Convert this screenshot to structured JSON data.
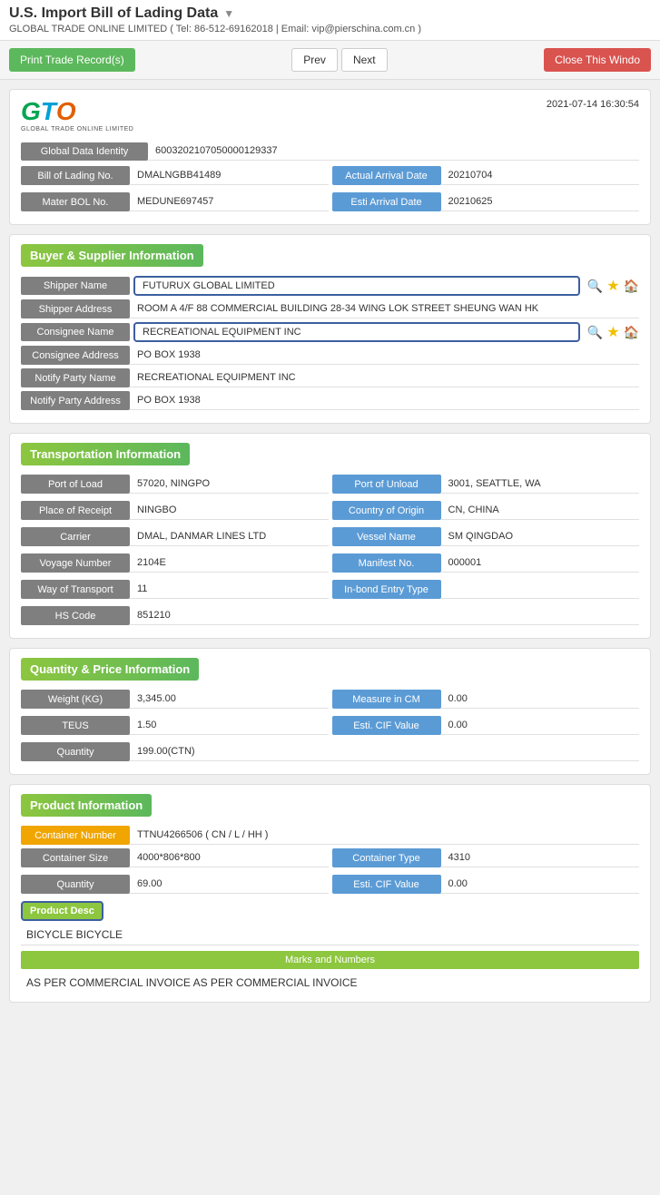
{
  "header": {
    "title": "U.S. Import Bill of Lading Data",
    "subtitle": "GLOBAL TRADE ONLINE LIMITED ( Tel: 86-512-69162018 | Email: vip@pierschina.com.cn )",
    "dropdown_arrow": "▼"
  },
  "toolbar": {
    "print_label": "Print Trade Record(s)",
    "prev_label": "Prev",
    "next_label": "Next",
    "close_label": "Close This Windo"
  },
  "record": {
    "timestamp": "2021-07-14 16:30:54",
    "global_data_identity_label": "Global Data Identity",
    "global_data_identity_value": "6003202107050000129337",
    "bill_of_lading_label": "Bill of Lading No.",
    "bill_of_lading_value": "DMALNGBB41489",
    "actual_arrival_label": "Actual Arrival Date",
    "actual_arrival_value": "20210704",
    "mater_bol_label": "Mater BOL No.",
    "mater_bol_value": "MEDUNE697457",
    "esti_arrival_label": "Esti Arrival Date",
    "esti_arrival_value": "20210625"
  },
  "buyer_supplier": {
    "section_title": "Buyer & Supplier Information",
    "shipper_name_label": "Shipper Name",
    "shipper_name_value": "FUTURUX GLOBAL LIMITED",
    "shipper_address_label": "Shipper Address",
    "shipper_address_value": "ROOM A 4/F 88 COMMERCIAL BUILDING 28-34 WING LOK STREET SHEUNG WAN HK",
    "consignee_name_label": "Consignee Name",
    "consignee_name_value": "RECREATIONAL EQUIPMENT INC",
    "consignee_address_label": "Consignee Address",
    "consignee_address_value": "PO BOX 1938",
    "notify_party_name_label": "Notify Party Name",
    "notify_party_name_value": "RECREATIONAL EQUIPMENT INC",
    "notify_party_address_label": "Notify Party Address",
    "notify_party_address_value": "PO BOX 1938"
  },
  "transportation": {
    "section_title": "Transportation Information",
    "port_of_load_label": "Port of Load",
    "port_of_load_value": "57020, NINGPO",
    "port_of_unload_label": "Port of Unload",
    "port_of_unload_value": "3001, SEATTLE, WA",
    "place_of_receipt_label": "Place of Receipt",
    "place_of_receipt_value": "NINGBO",
    "country_of_origin_label": "Country of Origin",
    "country_of_origin_value": "CN, CHINA",
    "carrier_label": "Carrier",
    "carrier_value": "DMAL, DANMAR LINES LTD",
    "vessel_name_label": "Vessel Name",
    "vessel_name_value": "SM QINGDAO",
    "voyage_number_label": "Voyage Number",
    "voyage_number_value": "2104E",
    "manifest_no_label": "Manifest No.",
    "manifest_no_value": "000001",
    "way_of_transport_label": "Way of Transport",
    "way_of_transport_value": "11",
    "in_bond_entry_label": "In-bond Entry Type",
    "in_bond_entry_value": "",
    "hs_code_label": "HS Code",
    "hs_code_value": "851210"
  },
  "quantity_price": {
    "section_title": "Quantity & Price Information",
    "weight_label": "Weight (KG)",
    "weight_value": "3,345.00",
    "measure_label": "Measure in CM",
    "measure_value": "0.00",
    "teus_label": "TEUS",
    "teus_value": "1.50",
    "esti_cif_label": "Esti. CIF Value",
    "esti_cif_value": "0.00",
    "quantity_label": "Quantity",
    "quantity_value": "199.00(CTN)"
  },
  "product": {
    "section_title": "Product Information",
    "container_number_label": "Container Number",
    "container_number_value": "TTNU4266506 ( CN / L / HH )",
    "container_size_label": "Container Size",
    "container_size_value": "4000*806*800",
    "container_type_label": "Container Type",
    "container_type_value": "4310",
    "quantity_label": "Quantity",
    "quantity_value": "69.00",
    "esti_cif_label": "Esti. CIF Value",
    "esti_cif_value": "0.00",
    "product_desc_label": "Product Desc",
    "product_desc_value": "BICYCLE BICYCLE",
    "marks_label": "Marks and Numbers",
    "marks_value": "AS PER COMMERCIAL INVOICE AS PER COMMERCIAL INVOICE"
  },
  "icons": {
    "search": "🔍",
    "star": "★",
    "home": "🏠",
    "dropdown": "▼"
  }
}
